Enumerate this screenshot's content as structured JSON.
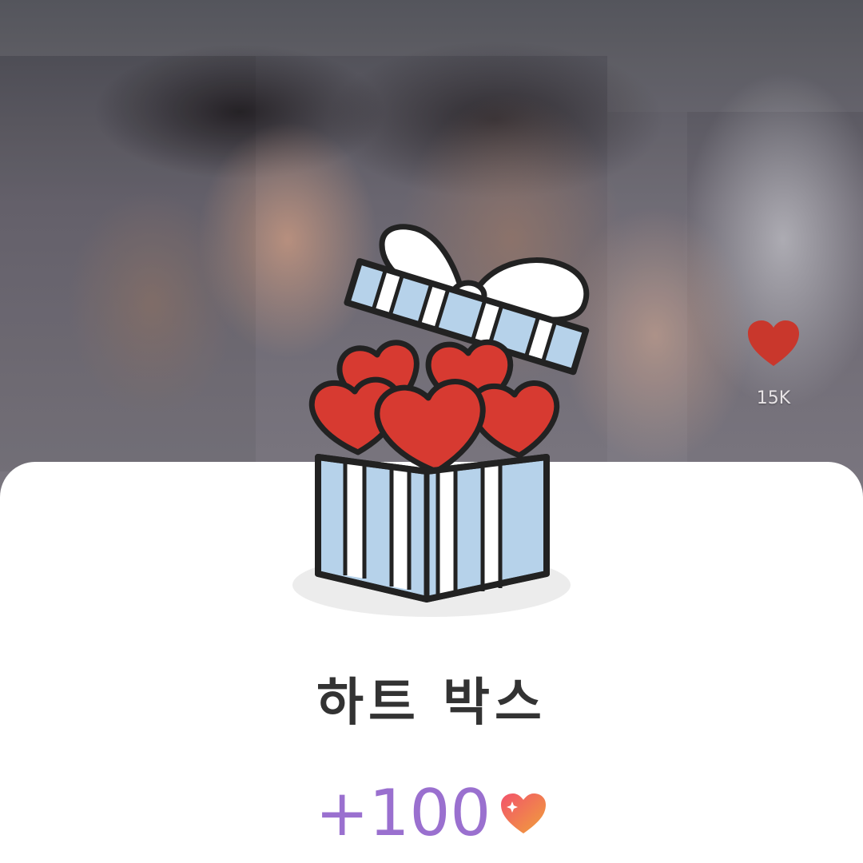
{
  "video": {
    "like_count": "15K",
    "like_icon": "heart-icon",
    "like_color": "#cc3b2f"
  },
  "gift_sheet": {
    "title": "하트 박스",
    "reward_amount": "+100",
    "reward_icon": "heart-sparkle-icon",
    "illustration": "gift-box-with-hearts-icon",
    "colors": {
      "reward_text": "#9a70cf",
      "box_blue": "#b6d2ea",
      "heart_red": "#d73a31",
      "title_text": "#333333"
    }
  }
}
